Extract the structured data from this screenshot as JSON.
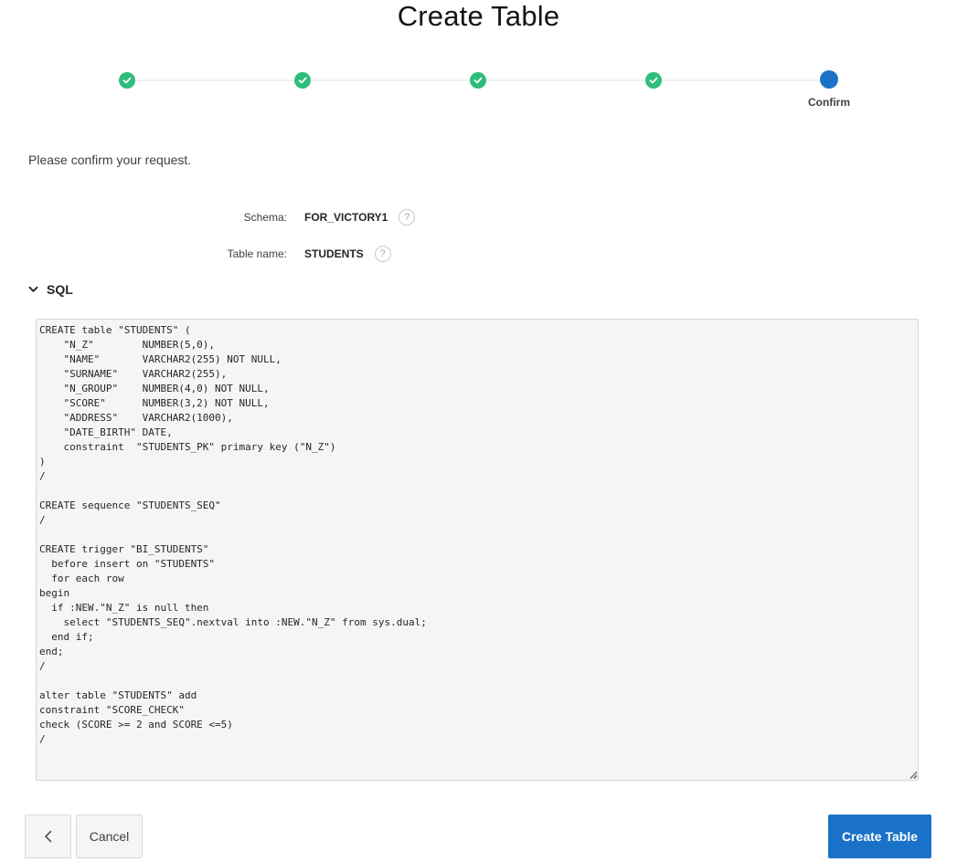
{
  "page": {
    "title": "Create Table"
  },
  "wizard": {
    "current_step_label": "Confirm",
    "completed_steps": 4
  },
  "instruction": "Please confirm your request.",
  "fields": {
    "schema": {
      "label": "Schema:",
      "value": "FOR_VICTORY1",
      "help_icon": "question-circle-icon"
    },
    "table_name": {
      "label": "Table name:",
      "value": "STUDENTS",
      "help_icon": "question-circle-icon"
    }
  },
  "sql_region": {
    "title": "SQL",
    "toggle_icon": "chevron-down-icon",
    "code": "CREATE table \"STUDENTS\" (\n    \"N_Z\"        NUMBER(5,0),\n    \"NAME\"       VARCHAR2(255) NOT NULL,\n    \"SURNAME\"    VARCHAR2(255),\n    \"N_GROUP\"    NUMBER(4,0) NOT NULL,\n    \"SCORE\"      NUMBER(3,2) NOT NULL,\n    \"ADDRESS\"    VARCHAR2(1000),\n    \"DATE_BIRTH\" DATE,\n    constraint  \"STUDENTS_PK\" primary key (\"N_Z\")\n)\n/\n\nCREATE sequence \"STUDENTS_SEQ\"\n/\n\nCREATE trigger \"BI_STUDENTS\"\n  before insert on \"STUDENTS\"\n  for each row\nbegin\n  if :NEW.\"N_Z\" is null then\n    select \"STUDENTS_SEQ\".nextval into :NEW.\"N_Z\" from sys.dual;\n  end if;\nend;\n/\n\nalter table \"STUDENTS\" add\nconstraint \"SCORE_CHECK\"\ncheck (SCORE >= 2 and SCORE <=5)\n/"
  },
  "buttons": {
    "previous_icon": "chevron-left-icon",
    "cancel": "Cancel",
    "create": "Create Table"
  },
  "colors": {
    "step_done": "#2ebd7a",
    "step_current": "#1a72c8",
    "primary_button": "#1a72c8"
  }
}
